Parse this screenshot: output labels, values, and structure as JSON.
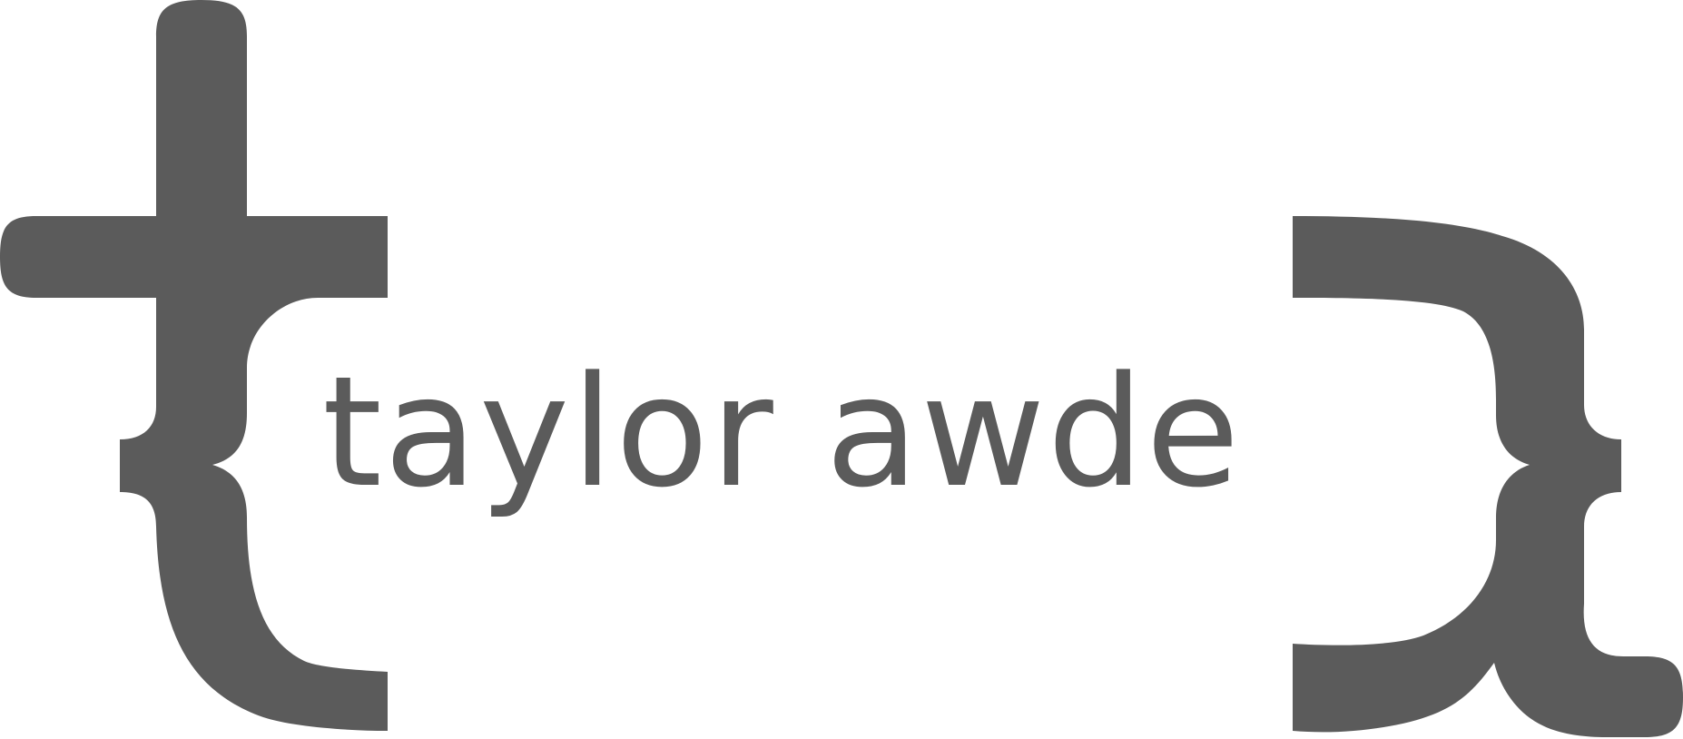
{
  "brand": {
    "wordmark": "taylor awde",
    "color": "#5b5b5b"
  },
  "icons": {
    "left": "stylized-t-brace-icon",
    "right": "stylized-a-brace-icon"
  }
}
